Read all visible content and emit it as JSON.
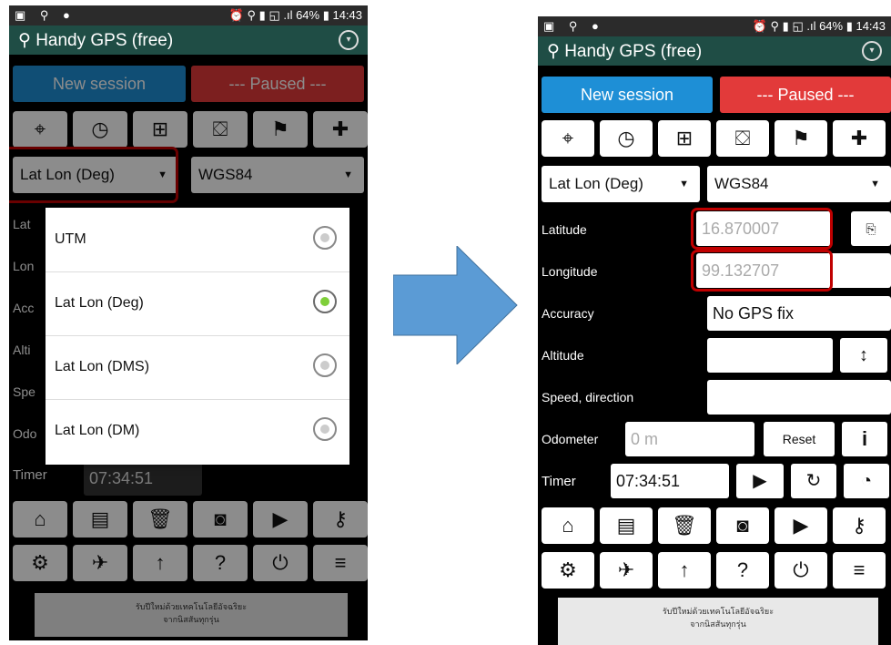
{
  "status": {
    "left_icons": "▣ ⚲ ●",
    "right": "⏰ ⚲ ▮ ◱ .ıl 64% ▮ 14:43"
  },
  "app": {
    "title": "Handy GPS (free)"
  },
  "buttons": {
    "new_session": "New session",
    "paused": "--- Paused ---"
  },
  "icons": {
    "row1": [
      "crosshair-icon",
      "compass-icon",
      "grid-icon",
      "map-icon",
      "flag-icon",
      "plus-icon"
    ],
    "row1_glyphs": [
      "⌖",
      "◷",
      "⊞",
      "⛋",
      "⚑",
      "✚"
    ],
    "row_files": [
      "⌂",
      "▤",
      "🗑",
      "◙",
      "▶",
      "⚷"
    ],
    "row_tools": [
      "⚙",
      "✈",
      "↑",
      "?",
      "⏻",
      "≡"
    ]
  },
  "selects": {
    "coord_format": "Lat Lon (Deg)",
    "datum": "WGS84"
  },
  "dialog": {
    "options": [
      {
        "label": "UTM",
        "selected": false
      },
      {
        "label": "Lat Lon (Deg)",
        "selected": true
      },
      {
        "label": "Lat Lon (DMS)",
        "selected": false
      },
      {
        "label": "Lat Lon (DM)",
        "selected": false
      }
    ]
  },
  "fields": {
    "latitude": {
      "label": "Latitude",
      "value": "16.870007"
    },
    "longitude": {
      "label": "Longitude",
      "value": "99.132707"
    },
    "accuracy": {
      "label": "Accuracy",
      "value": "No GPS fix"
    },
    "altitude": {
      "label": "Altitude",
      "value": ""
    },
    "speed": {
      "label": "Speed, direction",
      "value": ""
    },
    "odometer": {
      "label": "Odometer",
      "placeholder": "0 m",
      "reset": "Reset"
    },
    "timer": {
      "label": "Timer",
      "value": "07:34:51"
    }
  },
  "left_partial_labels": [
    "Lat",
    "Lon",
    "Acc",
    "Alti",
    "Spe",
    "Odo"
  ],
  "ad": {
    "line1": "รับปีใหม่ด้วยเทคโนโลยีอัจฉริยะ",
    "line2": "จากนิสสันทุกรุ่น"
  },
  "colors": {
    "title_bar": "#1f4d45",
    "new_session": "#1e8fd6",
    "paused": "#e23a3a",
    "highlight": "#c00000",
    "radio_on": "#7fcf3a",
    "arrow": "#5b9bd5"
  }
}
